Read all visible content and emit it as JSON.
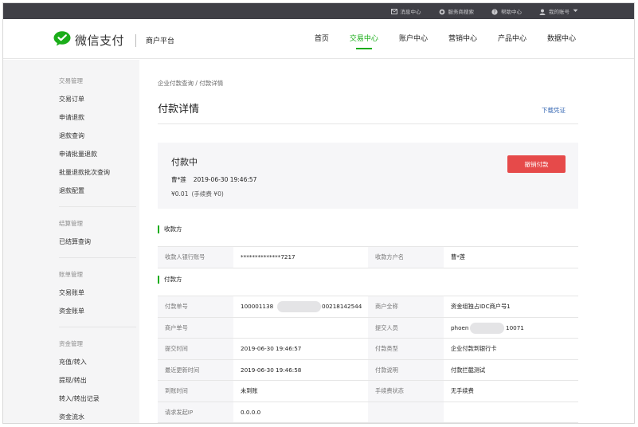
{
  "topbar": {
    "items": [
      {
        "icon": "mail-icon",
        "label": "消息中心"
      },
      {
        "icon": "search-icon",
        "label": "服务商搜索"
      },
      {
        "icon": "help-icon",
        "label": "帮助中心"
      },
      {
        "icon": "user-icon",
        "label": "我的账号"
      }
    ]
  },
  "header": {
    "brand": "微信支付",
    "platform": "商户平台",
    "nav": [
      "首页",
      "交易中心",
      "账户中心",
      "营销中心",
      "产品中心",
      "数据中心"
    ],
    "active_nav": "交易中心",
    "brand_color": "#1aad19"
  },
  "sidebar": {
    "groups": [
      {
        "title": "交易管理",
        "items": [
          "交易订单",
          "申请退款",
          "退款查询",
          "申请批量退款",
          "批量退款批次查询",
          "退款配置"
        ]
      },
      {
        "title": "结算管理",
        "items": [
          "已结算查询"
        ]
      },
      {
        "title": "账单管理",
        "items": [
          "交易账单",
          "资金账单"
        ]
      },
      {
        "title": "资金管理",
        "items": [
          "充值/转入",
          "提现/转出",
          "转入/转出记录",
          "资金流水"
        ]
      }
    ]
  },
  "main": {
    "breadcrumb": "企业付款查询 / 付款详情",
    "title": "付款详情",
    "download_label": "下载凭证",
    "status": {
      "title": "付款中",
      "payee_name": "曹*莲",
      "time": "2019-06-30 19:46:57",
      "amount": "¥0.01",
      "fee": "(手续费 ¥0)",
      "cancel_label": "撤销付款",
      "cancel_color": "#e64a4a"
    },
    "payee_section": {
      "title": "收款方",
      "rows": [
        {
          "k1": "收款人银行账号",
          "v1": "**************7217",
          "k2": "收款方户名",
          "v2": "曹*莲"
        }
      ]
    },
    "payer_section": {
      "title": "付款方",
      "rows": [
        {
          "k1": "付款单号",
          "v1a": "100001138",
          "v1b": "00218142544",
          "k2": "商户全称",
          "v2": "资金组独占IDC商户号1"
        },
        {
          "k1": "商户单号",
          "v1": "",
          "k2": "提交人员",
          "v2a": "phoen",
          "v2b": "10071"
        },
        {
          "k1": "提交时间",
          "v1": "2019-06-30 19:46:57",
          "k2": "付款类型",
          "v2": "企业付款到银行卡"
        },
        {
          "k1": "最近更新时间",
          "v1": "2019-06-30 19:46:58",
          "k2": "付款说明",
          "v2": "付款拦截测试"
        },
        {
          "k1": "到账时间",
          "v1": "未到账",
          "k2": "手续费状态",
          "v2": "无手续费"
        },
        {
          "k1": "请求发起IP",
          "v1": "0.0.0.0",
          "k2": "",
          "v2": ""
        }
      ]
    }
  }
}
